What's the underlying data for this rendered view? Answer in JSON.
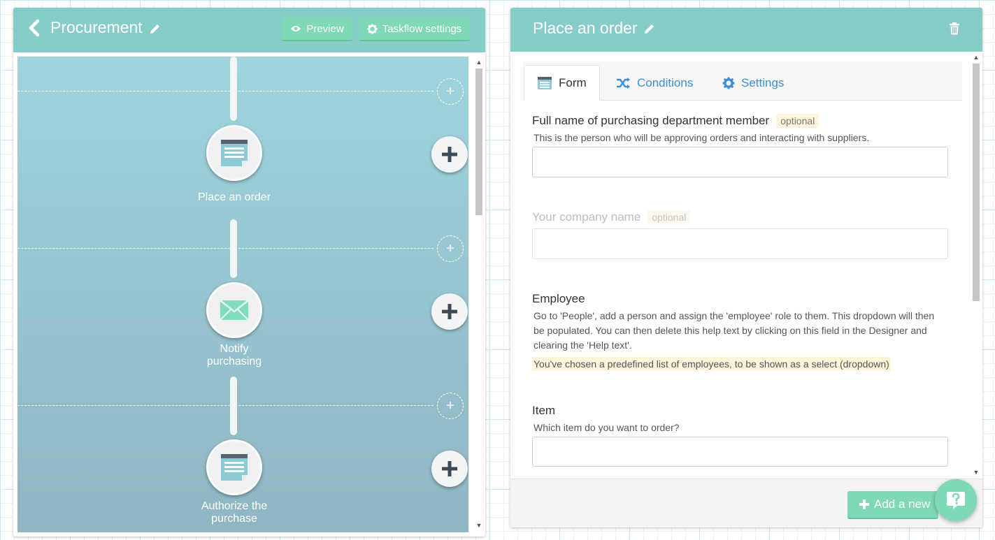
{
  "left": {
    "title": "Procurement",
    "preview_label": "Preview",
    "taskflow_settings_label": "Taskflow settings",
    "steps": [
      {
        "label": "Place an order"
      },
      {
        "label": "Notify purchasing"
      },
      {
        "label": "Authorize the purchase"
      }
    ],
    "icons": [
      "back-arrow",
      "pencil",
      "eye",
      "gear",
      "form-document",
      "envelope",
      "plus"
    ],
    "colors": {
      "header": "#86cdc9",
      "button": "#7fd8b6",
      "flow_bg_top": "#9ed4dd",
      "flow_bg_bottom": "#8fb6c2"
    }
  },
  "right": {
    "title": "Place an order",
    "tabs": [
      {
        "label": "Form"
      },
      {
        "label": "Conditions"
      },
      {
        "label": "Settings"
      }
    ],
    "fields": {
      "purchasing_member": {
        "label": "Full name of purchasing department member",
        "badge": "optional",
        "help": "This is the person who will be approving orders and interacting with suppliers.",
        "value": ""
      },
      "company_name": {
        "label": "Your company name",
        "badge": "optional",
        "value": ""
      },
      "employee": {
        "label": "Employee",
        "help": "Go to 'People', add a person and assign the 'employee' role to them. This dropdown will then be populated. You can then delete this help text by clicking on this field in the Designer and clearing the 'Help text'.",
        "note": "You've chosen a predefined list of employees, to be shown as a select (dropdown)"
      },
      "item": {
        "label": "Item",
        "help": "Which item do you want to order?",
        "value": ""
      }
    },
    "add_new_label": "Add a new"
  }
}
